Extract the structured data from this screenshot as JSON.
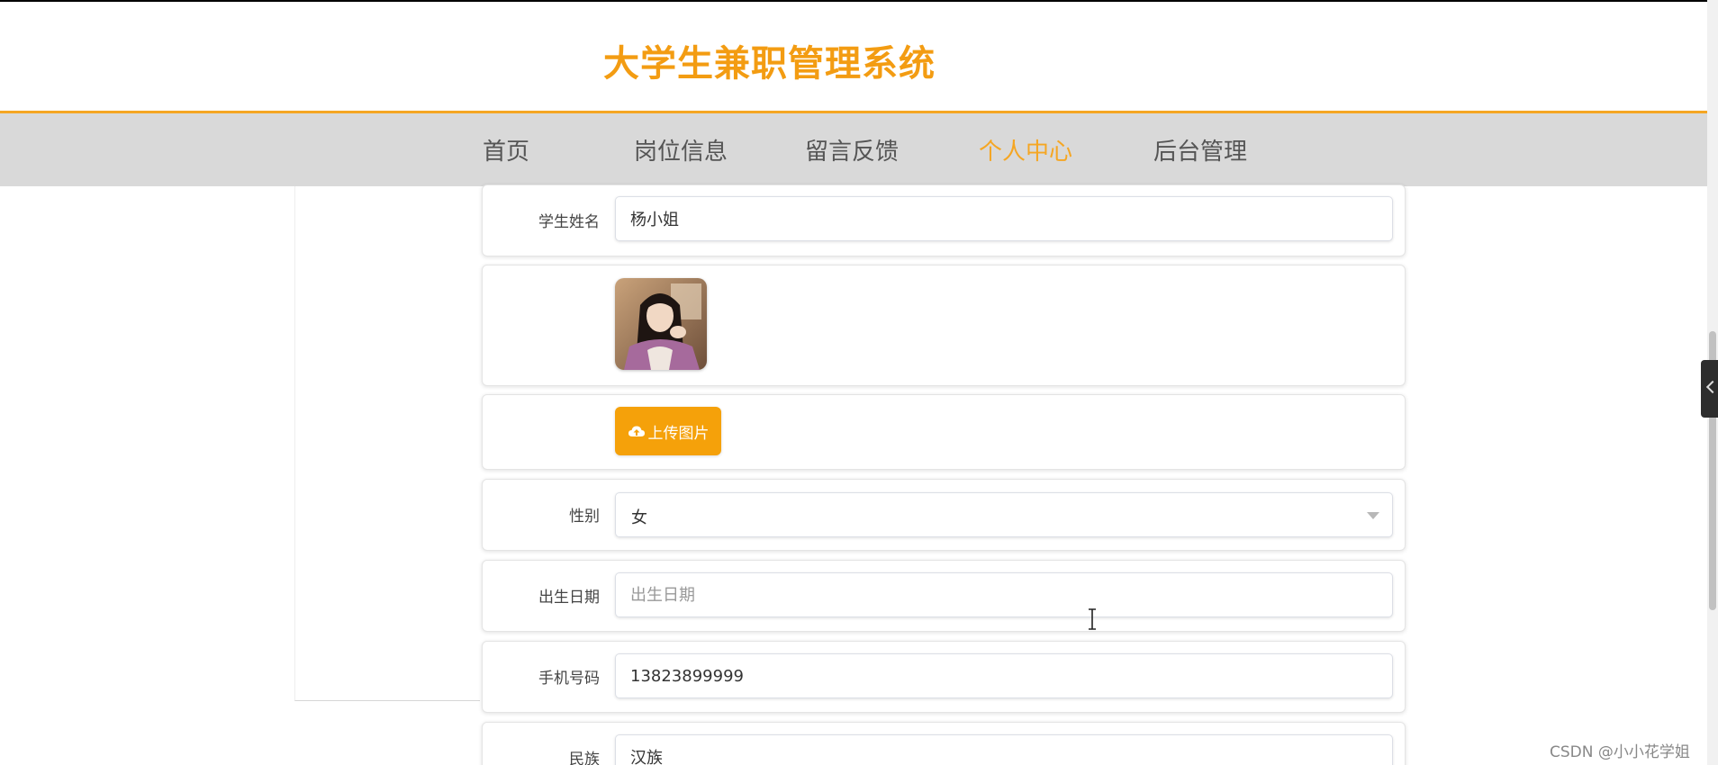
{
  "header": {
    "site_title": "大学生兼职管理系统"
  },
  "nav": {
    "items": [
      {
        "label": "首页"
      },
      {
        "label": "岗位信息"
      },
      {
        "label": "留言反馈"
      },
      {
        "label": "个人中心",
        "active": true
      },
      {
        "label": "后台管理"
      }
    ]
  },
  "form": {
    "student_name": {
      "label": "学生姓名",
      "value": "杨小姐"
    },
    "avatar": {
      "icon": "avatar-photo"
    },
    "upload": {
      "label": "上传图片",
      "icon": "cloud-upload-icon"
    },
    "gender": {
      "label": "性别",
      "value": "女"
    },
    "birth_date": {
      "label": "出生日期",
      "value": "",
      "placeholder": "出生日期"
    },
    "phone": {
      "label": "手机号码",
      "value": "13823899999"
    },
    "ethnicity": {
      "label": "民族",
      "value": "汉族"
    }
  },
  "colors": {
    "accent": "#f5a623",
    "title": "#f39c12",
    "nav_bg": "#d9d9d9",
    "button": "#f5a10a"
  },
  "watermark": "CSDN @小小花学姐"
}
